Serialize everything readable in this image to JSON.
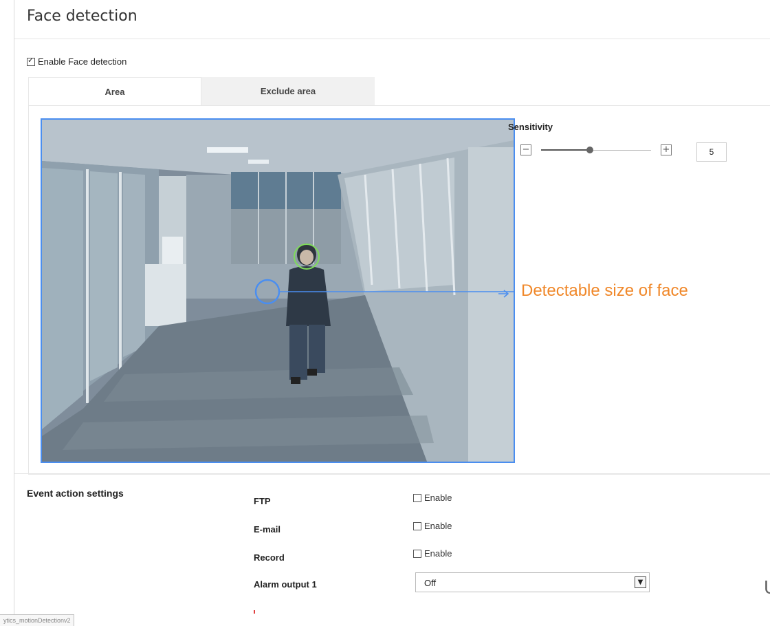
{
  "page": {
    "title": "Face detection"
  },
  "enable_face_detection": {
    "label": "Enable Face detection",
    "checked": true
  },
  "tabs": [
    {
      "label": "Area",
      "active": true
    },
    {
      "label": "Exclude area",
      "active": false
    }
  ],
  "sensitivity": {
    "label": "Sensitivity",
    "value": "5",
    "min": 1,
    "max": 10,
    "minus_icon": "minus-icon",
    "plus_icon": "plus-icon"
  },
  "annotation": {
    "text": "Detectable size of face",
    "color": "#f0882a",
    "line_color": "#4a8ef0"
  },
  "event_actions": {
    "title": "Event action settings",
    "rows": [
      {
        "label": "FTP",
        "enable_label": "Enable",
        "checked": false
      },
      {
        "label": "E-mail",
        "enable_label": "Enable",
        "checked": false
      },
      {
        "label": "Record",
        "enable_label": "Enable",
        "checked": false
      }
    ],
    "alarm_output": {
      "label": "Alarm output 1",
      "selected": "Off"
    }
  },
  "status_bar": {
    "text": "ytics_motionDetectionv2"
  },
  "edge_fragment": {
    "text": "U"
  }
}
